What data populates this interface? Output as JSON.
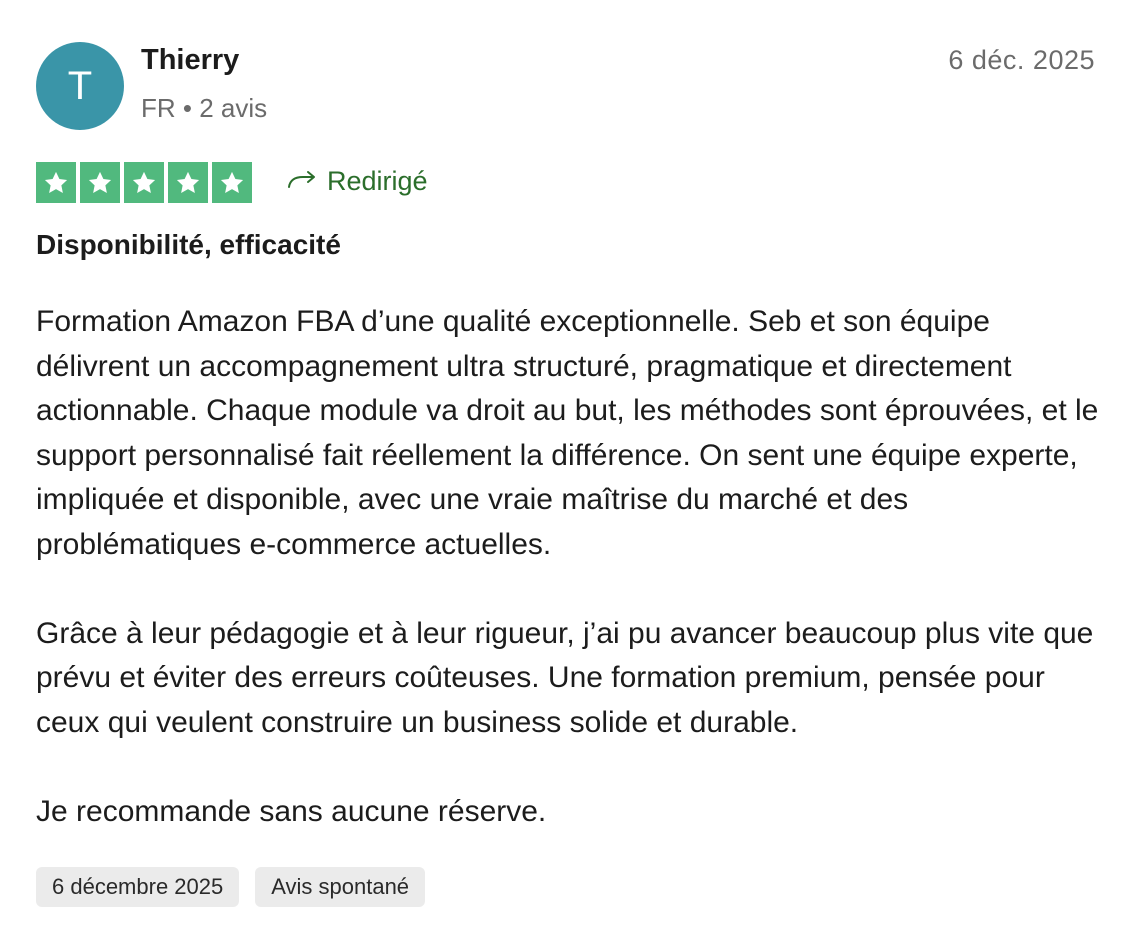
{
  "reviewer": {
    "initial": "T",
    "name": "Thierry",
    "meta": "FR • 2 avis",
    "avatar_color": "#3a95a8"
  },
  "review": {
    "date_short": "6 déc. 2025",
    "rating": 5,
    "rating_max": 5,
    "star_color": "#51b97e",
    "redirect_label": "Redirigé",
    "redirect_color": "#2b6e2b",
    "title": "Disponibilité, efficacité",
    "paragraphs": [
      "Formation Amazon FBA d’une qualité exceptionnelle. Seb et son équipe délivrent un accompagnement ultra structuré, pragmatique et directement actionnable. Chaque module va droit au but, les méthodes sont éprouvées, et le support personnalisé fait réellement la différence. On sent une équipe experte, impliquée et disponible, avec une vraie maîtrise du marché et des problématiques e-commerce actuelles.",
      "Grâce à leur pédagogie et à leur rigueur, j’ai pu avancer beaucoup plus vite que prévu et éviter des erreurs coûteuses. Une formation premium, pensée pour ceux qui veulent construire un business solide et durable.",
      "Je recommande sans aucune réserve."
    ],
    "tags": [
      "6 décembre 2025",
      "Avis spontané"
    ]
  }
}
